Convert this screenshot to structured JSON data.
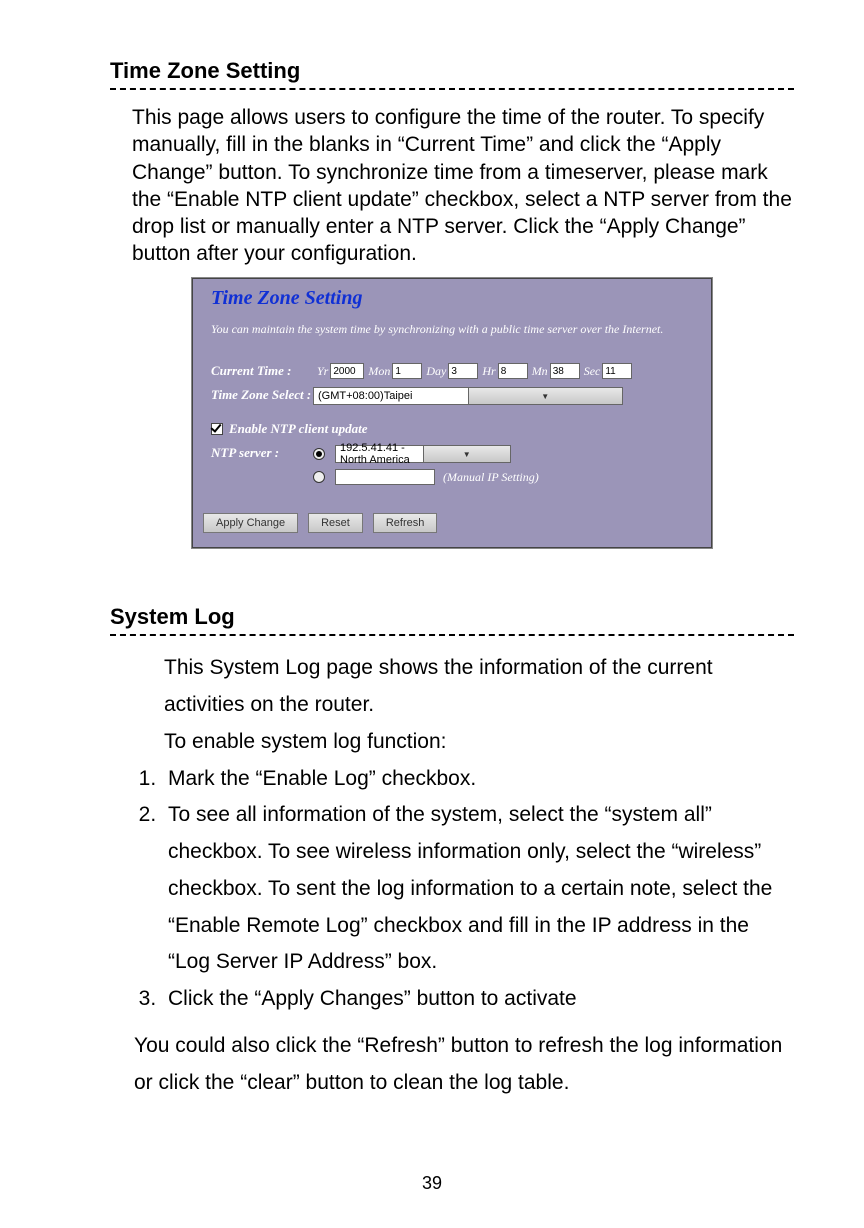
{
  "section1": {
    "heading": "Time Zone Setting",
    "para": "This page allows users to configure the time of the router. To specify manually, fill in the blanks in “Current Time” and click the “Apply Change” button. To synchronize time from a timeserver, please mark the “Enable NTP client update” checkbox, select a NTP server from the drop list or manually enter a NTP server. Click the “Apply Change” button after your configuration."
  },
  "shot": {
    "title": "Time Zone Setting",
    "sub": "You can maintain the system time by synchronizing with a public time server over the Internet.",
    "current_time_label": "Current Time :",
    "labels": {
      "yr": "Yr",
      "mon": "Mon",
      "day": "Day",
      "hr": "Hr",
      "mn": "Mn",
      "sec": "Sec"
    },
    "values": {
      "yr": "2000",
      "mon": "1",
      "day": "3",
      "hr": "8",
      "mn": "38",
      "sec": "11"
    },
    "tz_label": "Time Zone Select :",
    "tz_value": "(GMT+08:00)Taipei",
    "enable_ntp": "Enable NTP client update",
    "ntp_label": "NTP server :",
    "ntp_selected": "192.5.41.41 - North America",
    "manual_label": "(Manual IP Setting)",
    "buttons": {
      "apply": "Apply Change",
      "reset": "Reset",
      "refresh": "Refresh"
    }
  },
  "section2": {
    "heading": "System Log",
    "p1": "This System Log page shows the information of the current activities on the router.",
    "p2": "To enable system log function:",
    "items": [
      "Mark the “Enable Log” checkbox.",
      "To see all information of the system, select the “system all” checkbox. To see wireless information only, select the “wireless” checkbox. To sent the log information to a certain note, select the “Enable Remote Log” checkbox and fill in the IP address in the “Log Server IP Address” box.",
      "Click the “Apply Changes” button to activate"
    ],
    "tail": "You could also click the “Refresh” button to refresh the log information or click the “clear” button to clean the log table."
  },
  "page_number": "39"
}
